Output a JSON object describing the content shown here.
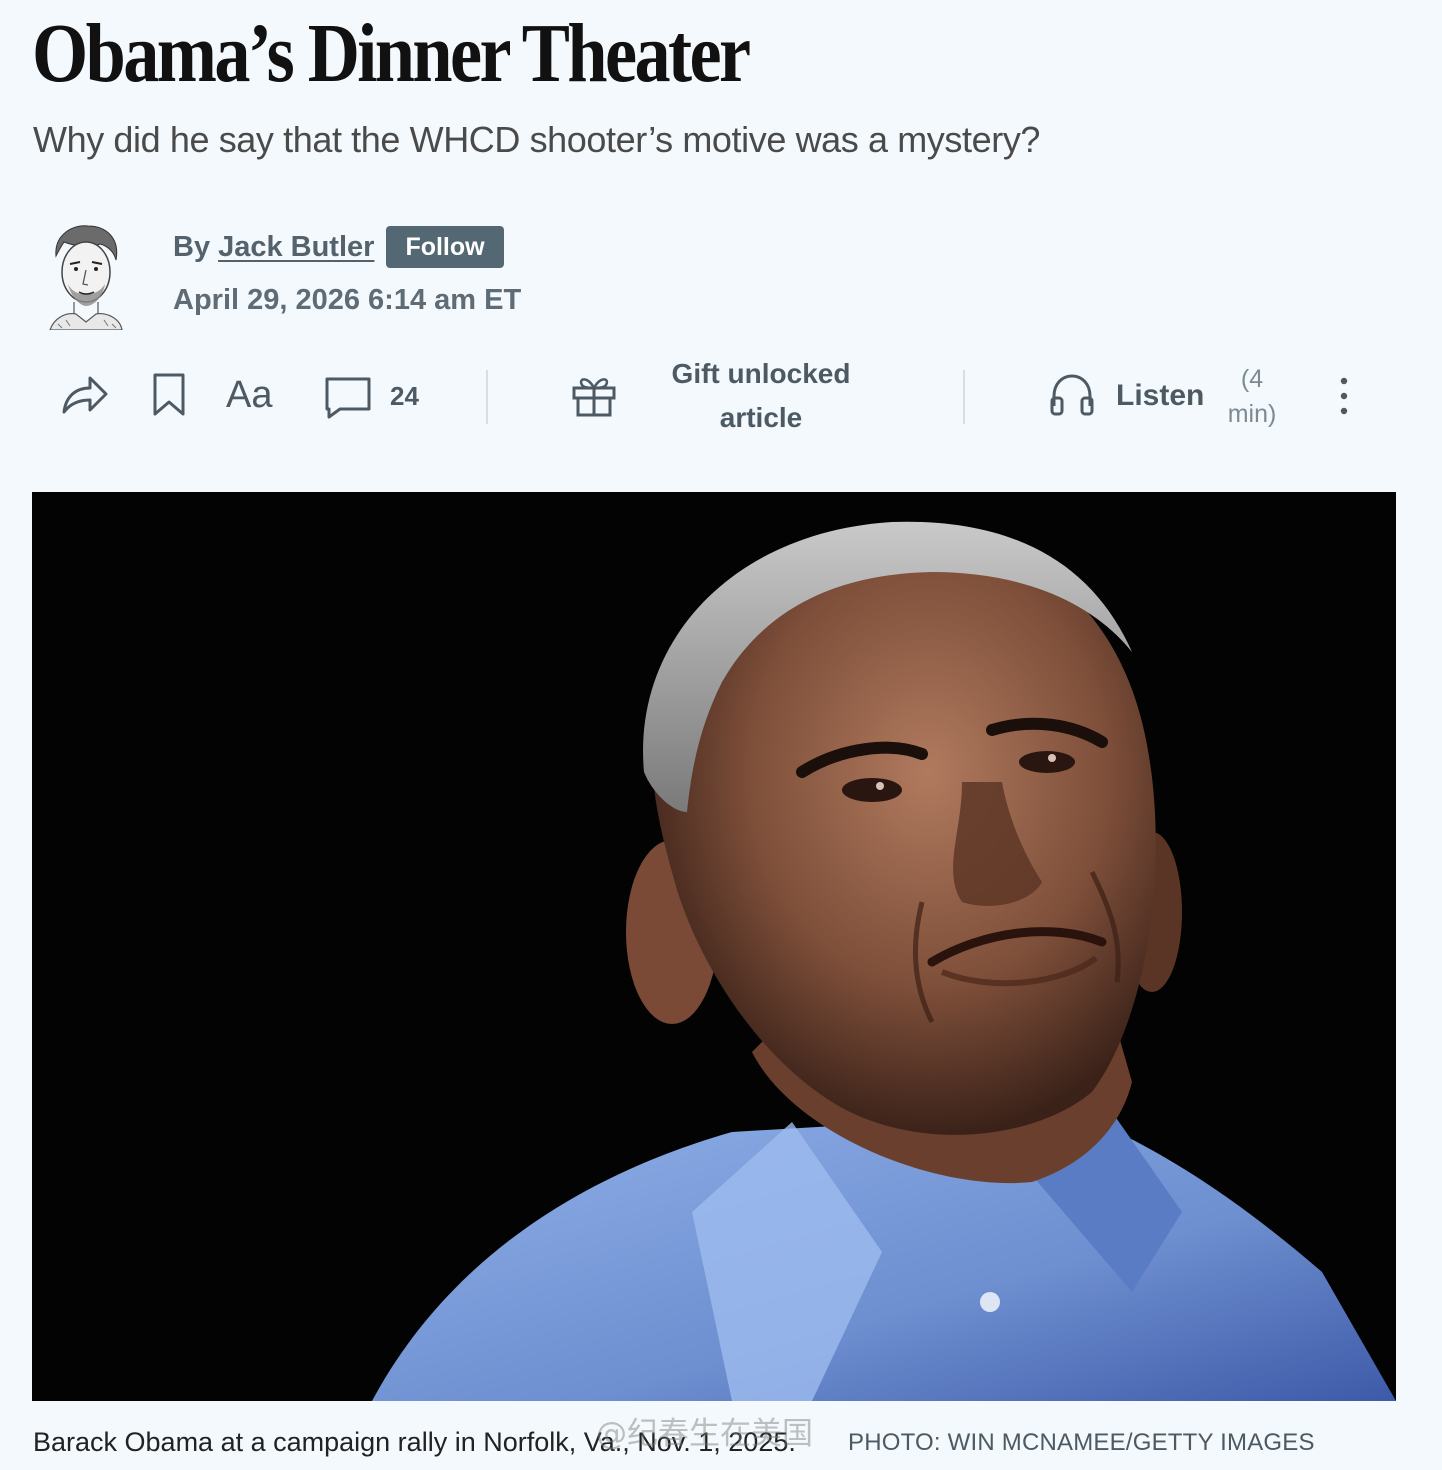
{
  "article": {
    "headline": "Obama’s Dinner Theater",
    "dek": "Why did he say that the WHCD shooter’s motive was a mystery?"
  },
  "byline": {
    "prefix": "By",
    "author": "Jack Butler",
    "follow_label": "Follow",
    "timestamp": "April 29, 2026 6:14 am ET"
  },
  "toolbar": {
    "share_icon": "share-arrow-icon",
    "bookmark_icon": "bookmark-icon",
    "text_size_label": "Aa",
    "comment_icon": "comment-bubble-icon",
    "comment_count": "24",
    "gift_icon": "gift-icon",
    "gift_label_line1": "Gift unlocked",
    "gift_label_line2": "article",
    "listen_icon": "headphones-icon",
    "listen_label": "Listen",
    "listen_duration_line1": "(4",
    "listen_duration_line2": "min)",
    "more_icon": "more-vertical-icon"
  },
  "image": {
    "caption": "Barack Obama at a campaign rally in Norfolk, Va., Nov. 1, 2025.",
    "credit": "PHOTO: WIN MCNAMEE/GETTY IMAGES"
  },
  "overlay": {
    "watermark": "@纪春生在美国"
  },
  "colors": {
    "background": "#f3f9fc",
    "accent": "#546873",
    "text_muted": "#53626d",
    "photo_background": "#030303",
    "shirt_blue": "#7f9fd6"
  }
}
